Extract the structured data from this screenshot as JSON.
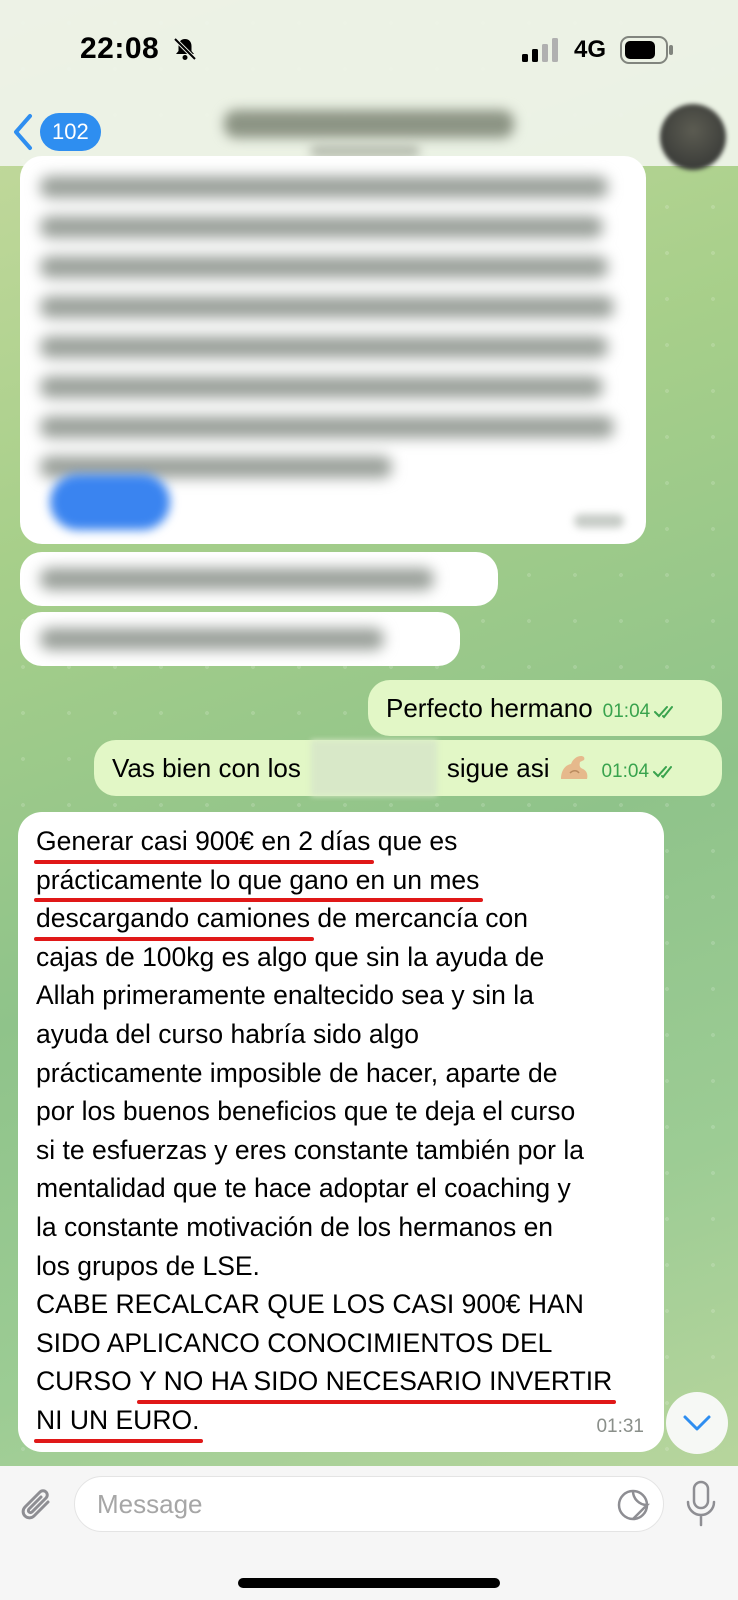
{
  "status_bar": {
    "time": "22:08",
    "network": "4G"
  },
  "nav": {
    "unread_count": "102",
    "title": "",
    "subtitle": ""
  },
  "messages": {
    "outgoing": [
      {
        "text": "Perfecto hermano",
        "time": "01:04"
      },
      {
        "text_before": "Vas bien con los",
        "text_after": "sigue asi",
        "time": "01:04",
        "emoji": "flexed-biceps-icon"
      }
    ],
    "incoming_main": {
      "time": "01:31",
      "lines": [
        {
          "u": "Generar casi 900€ en 2 días",
          "r": " que es"
        },
        {
          "u": "prácticamente lo que gano en un mes",
          "r": ""
        },
        {
          "u": "descargando camiones",
          "r": " de mercancía con"
        },
        {
          "u": "",
          "r": "cajas de 100kg es algo que sin la ayuda de"
        },
        {
          "u": "",
          "r": "Allah primeramente enaltecido sea y sin la"
        },
        {
          "u": "",
          "r": "ayuda del curso habría sido algo"
        },
        {
          "u": "",
          "r": "prácticamente imposible de hacer, aparte de"
        },
        {
          "u": "",
          "r": "por los buenos beneficios que te deja el curso"
        },
        {
          "u": "",
          "r": "si te esfuerzas y eres constante también por la"
        },
        {
          "u": "",
          "r": "mentalidad que te hace adoptar el coaching y"
        },
        {
          "u": "",
          "r": "la constante motivación de los hermanos en"
        },
        {
          "u": "",
          "r": "los grupos de LSE."
        },
        {
          "u": "",
          "r": "CABE RECALCAR QUE LOS CASI 900€ HAN"
        },
        {
          "u": "",
          "r": "SIDO APLICANCO CONOCIMIENTOS DEL"
        },
        {
          "p": "CURSO ",
          "u": "Y NO HA SIDO NECESARIO INVERTIR",
          "r": ""
        },
        {
          "u": "NI UN EURO.",
          "r": ""
        }
      ]
    }
  },
  "input": {
    "placeholder": "Message"
  },
  "colors": {
    "outgoing_bubble": "#e2f7c6",
    "incoming_bubble": "#ffffff",
    "accent": "#2e8ef0",
    "underline": "#e01818",
    "check": "#39a34d"
  }
}
